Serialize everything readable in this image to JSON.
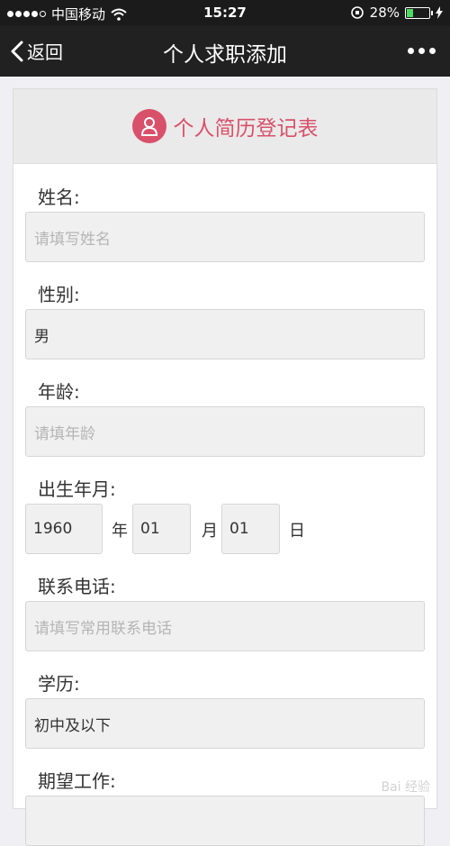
{
  "status_bar": {
    "carrier": "中国移动",
    "time": "15:27",
    "battery": "28%",
    "battery_level": 0.28
  },
  "nav": {
    "back_label": "返回",
    "title": "个人求职添加"
  },
  "form": {
    "header_title": "个人简历登记表",
    "name_label": "姓名:",
    "name_placeholder": "请填写姓名",
    "gender_label": "性别:",
    "gender_value": "男",
    "age_label": "年龄:",
    "age_placeholder": "请填年龄",
    "birth_label": "出生年月:",
    "birth_year": "1960",
    "year_unit": "年",
    "birth_month": "01",
    "month_unit": "月",
    "birth_day": "01",
    "day_unit": "日",
    "phone_label": "联系电话:",
    "phone_placeholder": "请填写常用联系电话",
    "education_label": "学历:",
    "education_value": "初中及以下",
    "job_label": "期望工作:"
  },
  "watermark": "Bai 经验"
}
